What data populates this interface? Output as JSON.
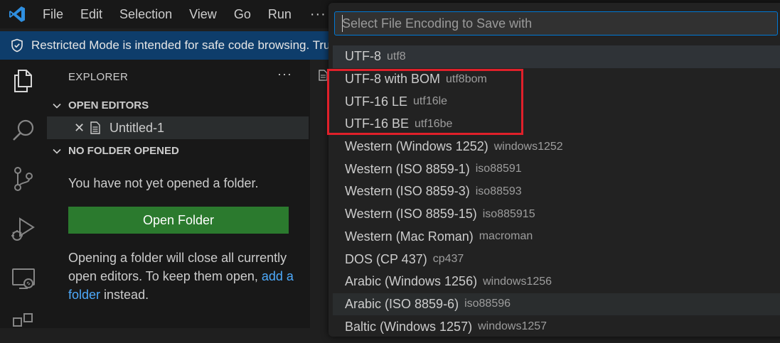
{
  "titlebar": {
    "menu": [
      "File",
      "Edit",
      "Selection",
      "View",
      "Go",
      "Run"
    ],
    "more": "···"
  },
  "banner": {
    "text": "Restricted Mode is intended for safe code browsing. Tru"
  },
  "sidebar": {
    "title": "EXPLORER",
    "more": "···",
    "open_editors": {
      "header": "OPEN EDITORS",
      "close_glyph": "✕",
      "file_name": "Untitled-1"
    },
    "no_folder": {
      "header": "NO FOLDER OPENED",
      "message": "You have not yet opened a folder.",
      "button": "Open Folder",
      "hint_before": "Opening a folder will close all currently open editors. To keep them open, ",
      "hint_link": "add a folder",
      "hint_after": " instead."
    }
  },
  "activity_icons": [
    "explorer-icon",
    "search-icon",
    "source-control-icon",
    "run-debug-icon",
    "remote-explorer-icon",
    "extensions-icon"
  ],
  "quickpick": {
    "placeholder": "Select File Encoding to Save with",
    "items": [
      {
        "label": "UTF-8",
        "desc": "utf8"
      },
      {
        "label": "UTF-8 with BOM",
        "desc": "utf8bom"
      },
      {
        "label": "UTF-16 LE",
        "desc": "utf16le"
      },
      {
        "label": "UTF-16 BE",
        "desc": "utf16be"
      },
      {
        "label": "Western (Windows 1252)",
        "desc": "windows1252"
      },
      {
        "label": "Western (ISO 8859-1)",
        "desc": "iso88591"
      },
      {
        "label": "Western (ISO 8859-3)",
        "desc": "iso88593"
      },
      {
        "label": "Western (ISO 8859-15)",
        "desc": "iso885915"
      },
      {
        "label": "Western (Mac Roman)",
        "desc": "macroman"
      },
      {
        "label": "DOS (CP 437)",
        "desc": "cp437"
      },
      {
        "label": "Arabic (Windows 1256)",
        "desc": "windows1256"
      },
      {
        "label": "Arabic (ISO 8859-6)",
        "desc": "iso88596"
      },
      {
        "label": "Baltic (Windows 1257)",
        "desc": "windows1257"
      }
    ]
  },
  "colors": {
    "accent": "#0078d4",
    "banner": "#0e3d6b",
    "button": "#2b7a2e",
    "highlight_box": "#e0202a",
    "link": "#4daafc"
  }
}
